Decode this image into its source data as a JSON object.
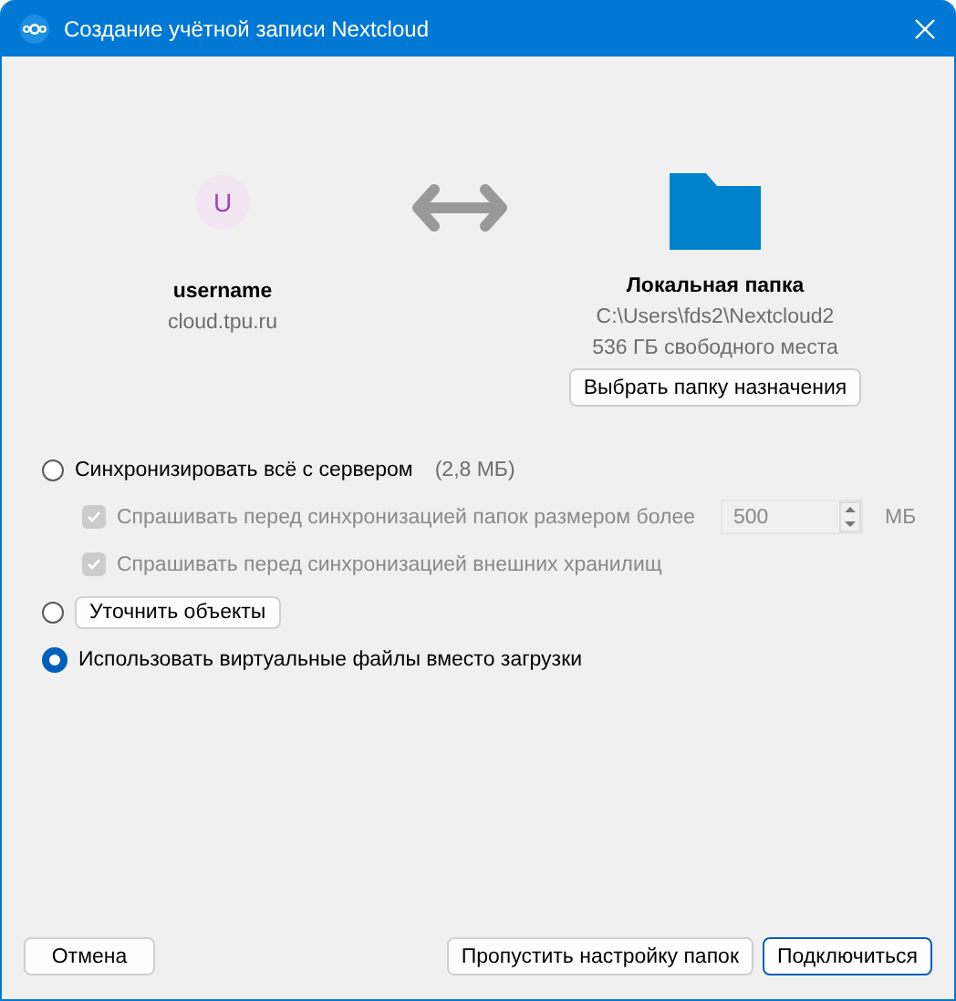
{
  "window": {
    "title": "Создание учётной записи Nextcloud"
  },
  "account": {
    "avatar_letter": "U",
    "username": "username",
    "host": "cloud.tpu.ru"
  },
  "local": {
    "title": "Локальная папка",
    "path": "C:\\Users\\fds2\\Nextcloud2",
    "free": "536 ГБ свободного места",
    "choose_button": "Выбрать папку назначения"
  },
  "options": [
    {
      "kind": "radio",
      "label": "Синхронизировать всё с сервером",
      "size": "(2,8 МБ)",
      "selected": false
    },
    {
      "kind": "checkbox",
      "label": "Спрашивать перед синхронизацией папок размером более",
      "checked": true,
      "disabled": true,
      "spin_value": "500",
      "unit": "МБ"
    },
    {
      "kind": "checkbox",
      "label": "Спрашивать перед синхронизацией внешних хранилищ",
      "checked": true,
      "disabled": true
    },
    {
      "kind": "radio-button",
      "label": "Уточнить объекты",
      "selected": false
    },
    {
      "kind": "radio",
      "label": "Использовать виртуальные файлы вместо загрузки",
      "selected": true
    }
  ],
  "buttons": {
    "cancel": "Отмена",
    "skip": "Пропустить настройку папок",
    "connect": "Подключиться"
  }
}
